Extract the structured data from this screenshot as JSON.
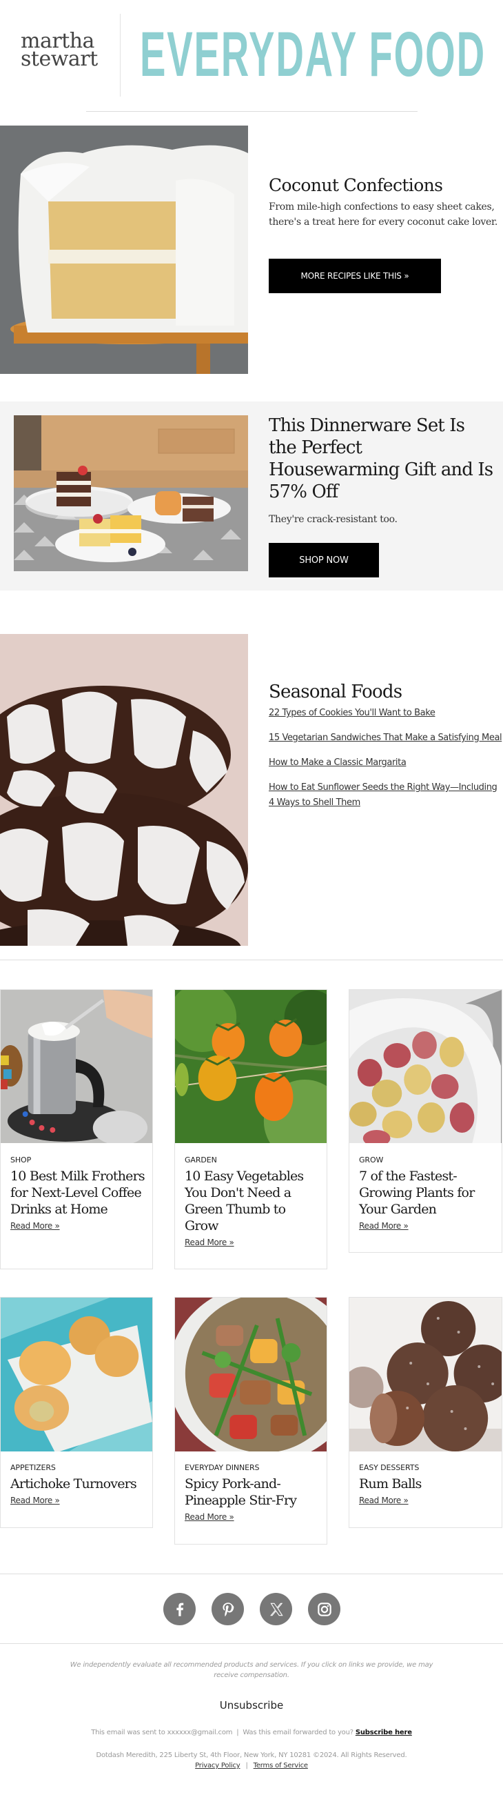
{
  "header": {
    "logo_line1": "martha",
    "logo_line2": "stewart",
    "brand_title": "EVERYDAY FOOD",
    "brand_color": "#8fcfd1"
  },
  "feature": {
    "title": "Coconut Confections",
    "description": "From mile-high confections to easy sheet cakes, there's a treat here for every coconut cake lover.",
    "button_label": "MORE RECIPES LIKE THIS »",
    "image_alt": "Coconut layer cake on cake stand"
  },
  "promo": {
    "title": "This Dinnerware Set Is the Perfect Housewarming Gift and Is 57% Off",
    "description": "They're crack-resistant too.",
    "button_label": "SHOP NOW",
    "image_alt": "Cake slices on white dinnerware plates",
    "background_color": "#f4f4f4"
  },
  "seasonal": {
    "title": "Seasonal Foods",
    "image_alt": "Chocolate crinkle cookies",
    "links": [
      "22 Types of Cookies You'll Want to Bake",
      "15 Vegetarian Sandwiches That Make a Satisfying Meal",
      "How to Make a Classic Margarita",
      "How to Eat Sunflower Seeds the Right Way—Including 4 Ways to Shell Them"
    ]
  },
  "cards": [
    {
      "category": "SHOP",
      "title": "10 Best Milk Frothers for Next-Level Coffee Drinks at Home",
      "link": "Read More »",
      "image_alt": "Milk frother"
    },
    {
      "category": "GARDEN",
      "title": "10 Easy Vegetables You Don't Need a Green Thumb to Grow",
      "link": "Read More »",
      "image_alt": "Cherry tomatoes on the vine"
    },
    {
      "category": "GROW",
      "title": "7 of the Fastest-Growing Plants for Your Garden",
      "link": "Read More »",
      "image_alt": "Bag of potatoes"
    },
    {
      "category": "APPETIZERS",
      "title": "Artichoke Turnovers",
      "link": "Read More »",
      "image_alt": "Artichoke turnovers"
    },
    {
      "category": "EVERYDAY DINNERS",
      "title": "Spicy Pork-and-Pineapple Stir-Fry",
      "link": "Read More »",
      "image_alt": "Pork and pineapple stir-fry"
    },
    {
      "category": "EASY DESSERTS",
      "title": "Rum Balls",
      "link": "Read More »",
      "image_alt": "Rum balls"
    }
  ],
  "social": [
    {
      "name": "facebook",
      "icon": "facebook-icon"
    },
    {
      "name": "pinterest",
      "icon": "pinterest-icon"
    },
    {
      "name": "x",
      "icon": "x-icon"
    },
    {
      "name": "instagram",
      "icon": "instagram-icon"
    }
  ],
  "footer": {
    "disclaimer": "We independently evaluate all recommended products and services. If you click on links we provide, we may receive compensation.",
    "unsubscribe": "Unsubscribe",
    "sent_to_prefix": "This email was sent to xxxxxx@gmail.com  |  Was this email forwarded to you?",
    "subscribe_link": "Subscribe here",
    "address": "Dotdash Meredith, 225 Liberty St, 4th Floor, New York, NY 10281 ©2024. All Rights Reserved.",
    "privacy_link": "Privacy Policy",
    "separator": "|",
    "terms_link": "Terms of Service"
  }
}
